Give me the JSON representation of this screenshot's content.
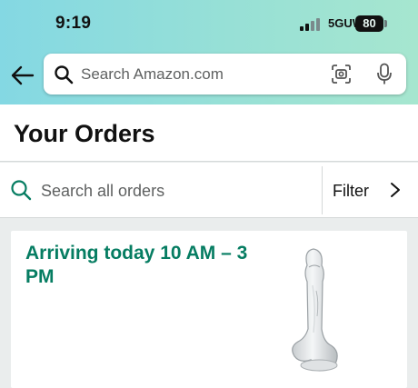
{
  "status_bar": {
    "time": "9:19",
    "network": "5GUW",
    "battery": "80"
  },
  "header": {
    "search_placeholder": "Search Amazon.com"
  },
  "page": {
    "title": "Your Orders"
  },
  "order_search": {
    "placeholder": "Search all orders",
    "filter_label": "Filter"
  },
  "orders": [
    {
      "status": "Arriving today 10 AM – 3 PM"
    }
  ],
  "colors": {
    "accent_green": "#067d62",
    "header_gradient_start": "#84d8e3",
    "header_gradient_end": "#a6e6cf"
  }
}
